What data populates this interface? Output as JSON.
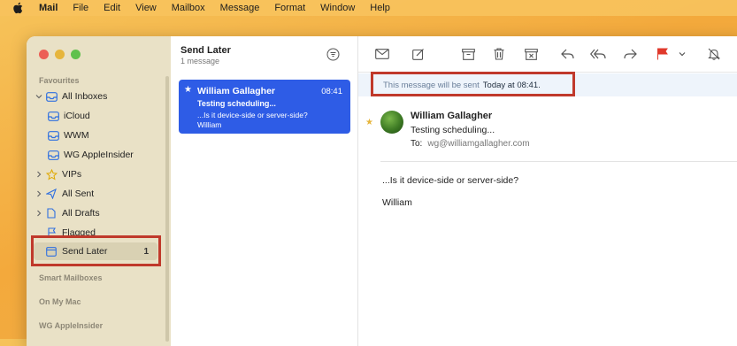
{
  "menubar": {
    "app_name": "Mail",
    "items": [
      "File",
      "Edit",
      "View",
      "Mailbox",
      "Message",
      "Format",
      "Window",
      "Help"
    ]
  },
  "sidebar": {
    "favourites_header": "Favourites",
    "items": [
      {
        "label": "All Inboxes",
        "icon": "tray-icon"
      },
      {
        "label": "iCloud",
        "icon": "tray-icon"
      },
      {
        "label": "WWM",
        "icon": "tray-icon"
      },
      {
        "label": "WG AppleInsider",
        "icon": "tray-icon"
      },
      {
        "label": "VIPs",
        "icon": "star-icon"
      },
      {
        "label": "All Sent",
        "icon": "paper-plane-icon"
      },
      {
        "label": "All Drafts",
        "icon": "document-icon"
      },
      {
        "label": "Flagged",
        "icon": "flag-icon"
      },
      {
        "label": "Send Later",
        "icon": "calendar-icon",
        "badge": "1"
      }
    ],
    "sections": [
      "Smart Mailboxes",
      "On My Mac",
      "WG AppleInsider"
    ]
  },
  "message_list": {
    "title": "Send Later",
    "count": "1 message",
    "message": {
      "from": "William Gallagher",
      "time": "08:41",
      "subject": "Testing scheduling...",
      "preview": "...Is it device-side or server-side? William"
    }
  },
  "reading_pane": {
    "banner_prefix": "This message will be sent",
    "banner_time": "Today at 08:41.",
    "from": "William Gallagher",
    "subject": "Testing scheduling...",
    "to_label": "To:",
    "to_address": "wg@williamgallagher.com",
    "body_line1": "...Is it device-side or server-side?",
    "body_line2": "William"
  },
  "colors": {
    "accent": "#2e5ce6",
    "highlight_box": "#c0392b",
    "flag": "#e0392b"
  }
}
